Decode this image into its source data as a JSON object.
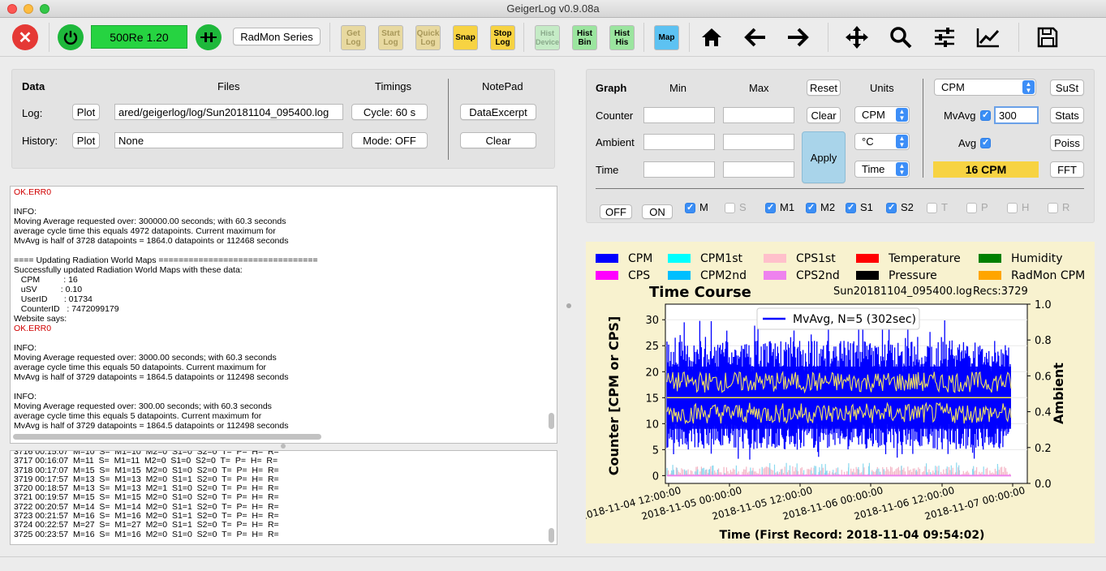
{
  "window": {
    "title": "GeigerLog v0.9.08a"
  },
  "toolbar": {
    "device_status": "500Re 1.20",
    "radmon_label": "RadMon Series",
    "buttons": {
      "get_log": "Get\nLog",
      "start_log": "Start\nLog",
      "quick_log": "Quick\nLog",
      "snap": "Snap",
      "stop_log": "Stop\nLog",
      "hist_device": "Hist\nDevice",
      "hist_bin": "Hist\nBin",
      "hist_his": "Hist\nHis",
      "map": "Map"
    },
    "colors": {
      "exit": "#e53935",
      "power": "#1eb83b",
      "status_bg": "#26d341",
      "yellow": "#f7d342",
      "yellow_dim": "#e8d9a0",
      "green_light": "#c5ebc6",
      "green": "#9be59f",
      "map_blue": "#5dc2f2"
    }
  },
  "files_panel": {
    "headers": {
      "data": "Data",
      "files": "Files",
      "timings": "Timings",
      "notepad": "NotePad"
    },
    "log_label": "Log:",
    "history_label": "History:",
    "plot_label": "Plot",
    "log_file": "ared/geigerlog/log/Sun20181104_095400.log",
    "history_file": "None",
    "cycle": "Cycle: 60 s",
    "mode": "Mode: OFF",
    "data_excerpt": "DataExcerpt",
    "clear": "Clear"
  },
  "graph_panel": {
    "headers": {
      "graph": "Graph",
      "min": "Min",
      "max": "Max",
      "units": "Units"
    },
    "rows": {
      "counter": "Counter",
      "ambient": "Ambient",
      "time": "Time"
    },
    "reset": "Reset",
    "clear": "Clear",
    "apply": "Apply",
    "unit_counter": "CPM",
    "unit_ambient": "°C",
    "unit_time": "Time",
    "var_select": "CPM",
    "mvavg_label": "MvAvg",
    "mvavg_value": "300",
    "avg_label": "Avg",
    "sust": "SuSt",
    "stats": "Stats",
    "poiss": "Poiss",
    "fft": "FFT",
    "current_value": "16 CPM",
    "off": "OFF",
    "on": "ON",
    "checks": [
      {
        "label": "M",
        "checked": true
      },
      {
        "label": "S",
        "checked": false
      },
      {
        "label": "M1",
        "checked": true
      },
      {
        "label": "M2",
        "checked": true
      },
      {
        "label": "S1",
        "checked": true
      },
      {
        "label": "S2",
        "checked": true
      },
      {
        "label": "T",
        "checked": false
      },
      {
        "label": "P",
        "checked": false
      },
      {
        "label": "H",
        "checked": false
      },
      {
        "label": "R",
        "checked": false
      }
    ]
  },
  "notes_log": [
    {
      "t": "OK.ERR0",
      "red": true
    },
    {
      "t": ""
    },
    {
      "t": "INFO:"
    },
    {
      "t": "Moving Average requested over: 300000.00 seconds; with 60.3 seconds"
    },
    {
      "t": "average cycle time this equals 4972 datapoints. Current maximum for"
    },
    {
      "t": "MvAvg is half of 3728 datapoints = 1864.0 datapoints or 112468 seconds"
    },
    {
      "t": ""
    },
    {
      "t": "==== Updating Radiation World Maps ================================"
    },
    {
      "t": "Successfully updated Radiation World Maps with these data:"
    },
    {
      "t": "   CPM          : 16"
    },
    {
      "t": "   uSV          : 0.10"
    },
    {
      "t": "   UserID       : 01734"
    },
    {
      "t": "   CounterID   : 7472099179"
    },
    {
      "t": "Website says:"
    },
    {
      "t": "OK.ERR0",
      "red": true
    },
    {
      "t": ""
    },
    {
      "t": "INFO:"
    },
    {
      "t": "Moving Average requested over: 3000.00 seconds; with 60.3 seconds"
    },
    {
      "t": "average cycle time this equals 50 datapoints. Current maximum for"
    },
    {
      "t": "MvAvg is half of 3729 datapoints = 1864.5 datapoints or 112498 seconds"
    },
    {
      "t": ""
    },
    {
      "t": "INFO:"
    },
    {
      "t": "Moving Average requested over: 300.00 seconds; with 60.3 seconds"
    },
    {
      "t": "average cycle time this equals 5 datapoints. Current maximum for"
    },
    {
      "t": "MvAvg is half of 3729 datapoints = 1864.5 datapoints or 112498 seconds"
    }
  ],
  "data_log": [
    "3716 00:15:07  M=10  S=  M1=10  M2=0  S1=0  S2=0  T=  P=  H=  R=",
    "3717 00:16:07  M=11  S=  M1=11  M2=0  S1=0  S2=0  T=  P=  H=  R=",
    "3718 00:17:07  M=15  S=  M1=15  M2=0  S1=0  S2=0  T=  P=  H=  R=",
    "3719 00:17:57  M=13  S=  M1=13  M2=0  S1=1  S2=0  T=  P=  H=  R=",
    "3720 00:18:57  M=13  S=  M1=13  M2=1  S1=0  S2=0  T=  P=  H=  R=",
    "3721 00:19:57  M=15  S=  M1=15  M2=0  S1=0  S2=0  T=  P=  H=  R=",
    "3722 00:20:57  M=14  S=  M1=14  M2=0  S1=1  S2=0  T=  P=  H=  R=",
    "3723 00:21:57  M=16  S=  M1=16  M2=0  S1=1  S2=0  T=  P=  H=  R=",
    "3724 00:22:57  M=27  S=  M1=27  M2=0  S1=1  S2=0  T=  P=  H=  R=",
    "3725 00:23:57  M=16  S=  M1=16  M2=0  S1=0  S2=0  T=  P=  H=  R="
  ],
  "chart_data": {
    "type": "line",
    "title": "Time Course",
    "file_label": "Sun20181104_095400.log",
    "recs_label": "Recs:3729",
    "xlabel": "Time (First Record: 2018-11-04 09:54:02)",
    "ylabel": "Counter  [CPM or CPS]",
    "y2label": "Ambient",
    "ylim": [
      -1.5,
      33
    ],
    "y2lim": [
      0.0,
      1.0
    ],
    "yticks": [
      "0",
      "5",
      "10",
      "15",
      "20",
      "25",
      "30"
    ],
    "y2ticks": [
      "0.0",
      "0.2",
      "0.4",
      "0.6",
      "0.8",
      "1.0"
    ],
    "xticks": [
      "2018-11-04  12:00:00",
      "2018-11-05  00:00:00",
      "2018-11-05  12:00:00",
      "2018-11-06  00:00:00",
      "2018-11-06  12:00:00",
      "2018-11-07  00:00:00"
    ],
    "mvavg_legend": "MvAvg, N=5 (302sec)",
    "legend": [
      {
        "name": "CPM",
        "color": "#0000ff"
      },
      {
        "name": "CPM1st",
        "color": "#00ffff"
      },
      {
        "name": "CPS1st",
        "color": "#ffc0cb"
      },
      {
        "name": "Temperature",
        "color": "#ff0000"
      },
      {
        "name": "Humidity",
        "color": "#008000"
      },
      {
        "name": "CPS",
        "color": "#ff00ff"
      },
      {
        "name": "CPM2nd",
        "color": "#00bfff"
      },
      {
        "name": "CPS2nd",
        "color": "#ee82ee"
      },
      {
        "name": "Pressure",
        "color": "#000000"
      },
      {
        "name": "RadMon CPM",
        "color": "#ffa500"
      }
    ],
    "series_summary": {
      "cpm_mean": 15,
      "cpm_band_low": 9,
      "cpm_band_high": 21,
      "cpm_max": 30,
      "cpm_min": 3,
      "mvavg_mean": 15
    }
  }
}
